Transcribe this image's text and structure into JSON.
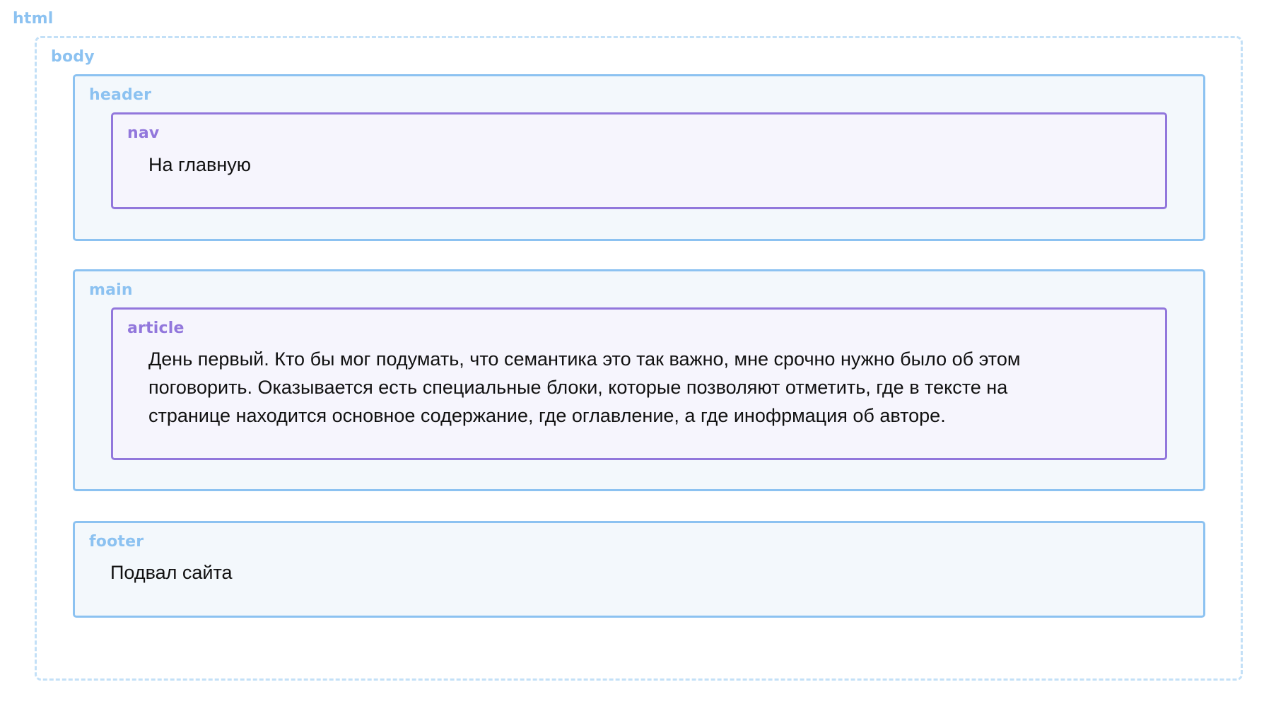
{
  "labels": {
    "html": "html",
    "body": "body",
    "header": "header",
    "nav": "nav",
    "main": "main",
    "article": "article",
    "footer": "footer"
  },
  "content": {
    "nav_text": "На главную",
    "article_text": "День первый. Кто бы мог подумать, что семантика это так важно, мне срочно нужно было об этом поговорить. Оказывается есть специальные блоки, которые позволяют отметить, где в тексте на странице находится основное содержание, где оглавление, а где инофрмация об авторе.",
    "footer_text": "Подвал сайта"
  },
  "colors": {
    "outer_label": "#8cc2f1",
    "outer_border": "#8cc2f1",
    "outer_fill": "#f3f8fc",
    "inner_label": "#9277dc",
    "inner_border": "#9277dc",
    "inner_fill": "#f6f5fd",
    "html_dashed_border": "#c3e0f7"
  }
}
